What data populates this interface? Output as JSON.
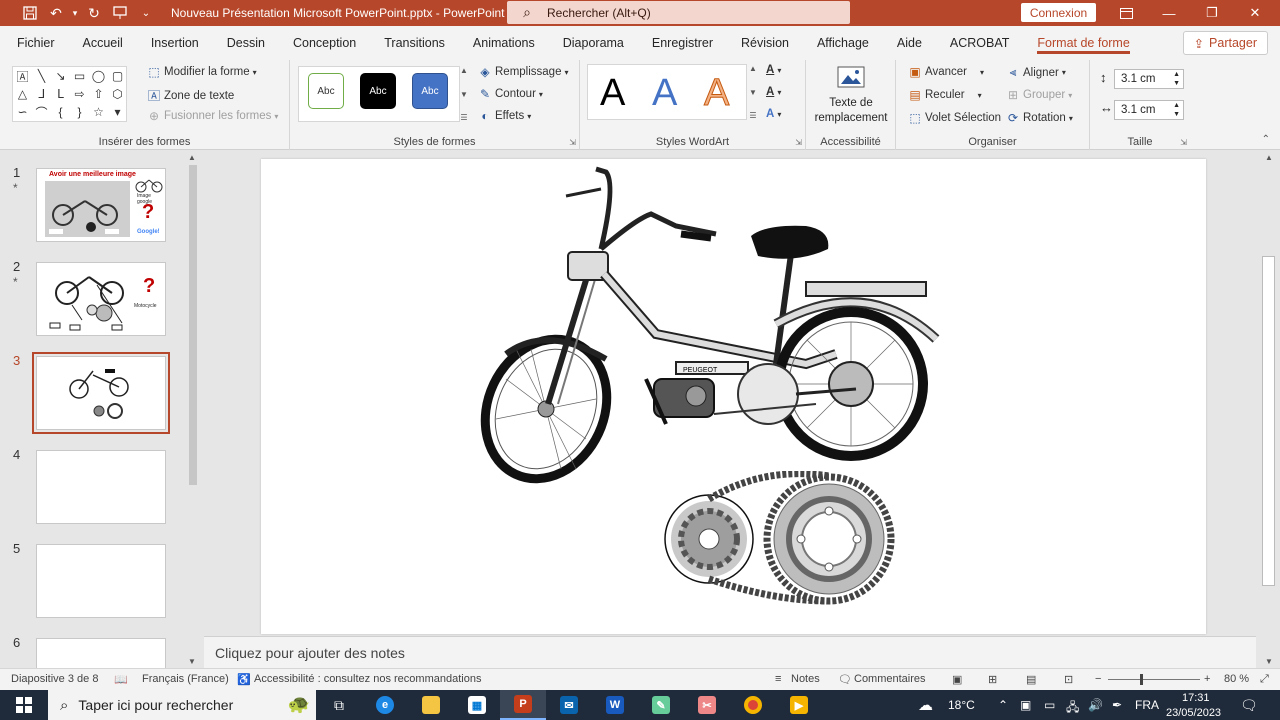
{
  "window": {
    "title": "Nouveau Présentation Microsoft PowerPoint.pptx  -  PowerPoint",
    "search_label": "Rechercher (Alt+Q)",
    "connexion": "Connexion"
  },
  "menu": {
    "tabs": [
      "Fichier",
      "Accueil",
      "Insertion",
      "Dessin",
      "Conception",
      "Transitions",
      "Animations",
      "Diaporama",
      "Enregistrer",
      "Révision",
      "Affichage",
      "Aide",
      "ACROBAT",
      "Format de forme"
    ],
    "active_tab": "Format de forme",
    "share": "Partager"
  },
  "ribbon": {
    "inserer": {
      "modifier": "Modifier la forme",
      "zone_texte": "Zone de texte",
      "fusionner": "Fusionner les formes",
      "label": "Insérer des formes"
    },
    "styles_formes": {
      "abc": "Abc",
      "remplissage": "Remplissage",
      "contour": "Contour",
      "effets": "Effets",
      "label": "Styles de formes"
    },
    "wordart": {
      "letter": "A",
      "label": "Styles WordArt"
    },
    "accessibilite": {
      "alt_text_line1": "Texte de",
      "alt_text_line2": "remplacement",
      "label": "Accessibilité"
    },
    "organiser": {
      "avancer": "Avancer",
      "reculer": "Reculer",
      "volet": "Volet Sélection",
      "aligner": "Aligner",
      "grouper": "Grouper",
      "rotation": "Rotation",
      "label": "Organiser"
    },
    "taille": {
      "height": "3.1 cm",
      "width": "3.1 cm",
      "label": "Taille"
    }
  },
  "thumbnails": [
    {
      "num": "1",
      "star": "*",
      "title": "Avoir une meilleure image",
      "labels": [
        "Image google",
        "Google!"
      ]
    },
    {
      "num": "2",
      "star": "*",
      "labels": [
        "Motocycle"
      ]
    },
    {
      "num": "3",
      "star": ""
    },
    {
      "num": "4",
      "star": ""
    },
    {
      "num": "5",
      "star": ""
    },
    {
      "num": "6",
      "star": ""
    }
  ],
  "slide": {
    "moped_brand": "PEUGEOT"
  },
  "notes_placeholder": "Cliquez pour ajouter des notes",
  "status": {
    "slide": "Diapositive 3 de 8",
    "language": "Français (France)",
    "accessibility": "Accessibilité : consultez nos recommandations",
    "notes": "Notes",
    "comments": "Commentaires",
    "zoom": "80 %"
  },
  "taskbar": {
    "search_placeholder": "Taper ici pour rechercher",
    "weather": "18°C",
    "lang": "FRA",
    "time": "17:31",
    "date": "23/05/2023"
  }
}
